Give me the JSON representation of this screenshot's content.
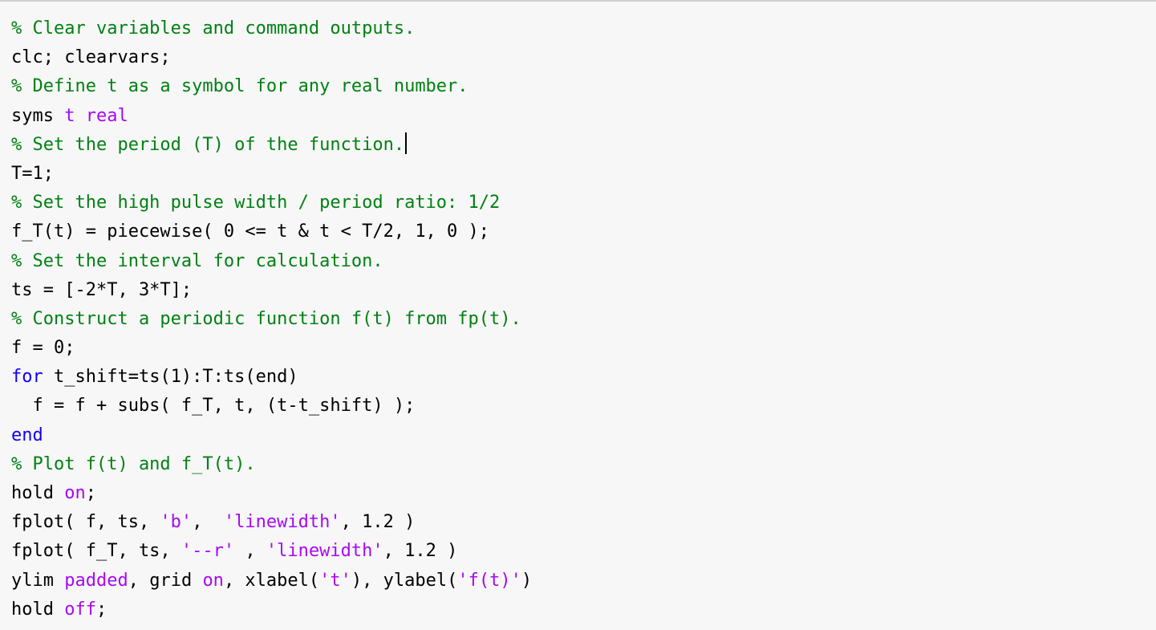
{
  "colors": {
    "background": "#f7f7f7",
    "comment": "#008013",
    "string": "#a709f5",
    "keyword": "#0e00ff",
    "plain": "#000000"
  },
  "editor": {
    "lines": [
      [
        {
          "t": "% Clear variables and command outputs.",
          "k": "comment"
        }
      ],
      [
        {
          "t": "clc; clearvars;",
          "k": "plain"
        }
      ],
      [
        {
          "t": "% Define t as a symbol for any real number.",
          "k": "comment"
        }
      ],
      [
        {
          "t": "syms ",
          "k": "plain"
        },
        {
          "t": "t real",
          "k": "string"
        }
      ],
      [
        {
          "t": "% Set the period (T) of the function.",
          "k": "comment"
        },
        {
          "cursor": true
        }
      ],
      [
        {
          "t": "T=1;",
          "k": "plain"
        }
      ],
      [
        {
          "t": "% Set the high pulse width / period ratio: 1/2",
          "k": "comment"
        }
      ],
      [
        {
          "t": "f_T(t) = piecewise( 0 <= t & t < T/2, 1, 0 );",
          "k": "plain"
        }
      ],
      [
        {
          "t": "% Set the interval for calculation.",
          "k": "comment"
        }
      ],
      [
        {
          "t": "ts = [-2*T, 3*T];",
          "k": "plain"
        }
      ],
      [
        {
          "t": "% Construct a periodic function f(t) from fp(t).",
          "k": "comment"
        }
      ],
      [
        {
          "t": "f = 0;",
          "k": "plain"
        }
      ],
      [
        {
          "t": "for",
          "k": "keyword"
        },
        {
          "t": " t_shift=ts(1):T:ts(end)",
          "k": "plain"
        }
      ],
      [
        {
          "t": "  f = f + subs( f_T, t, (t-t_shift) );",
          "k": "plain"
        }
      ],
      [
        {
          "t": "end",
          "k": "keyword"
        }
      ],
      [
        {
          "t": "% Plot f(t) and f_T(t).",
          "k": "comment"
        }
      ],
      [
        {
          "t": "hold ",
          "k": "plain"
        },
        {
          "t": "on",
          "k": "string"
        },
        {
          "t": ";",
          "k": "plain"
        }
      ],
      [
        {
          "t": "fplot( f, ts, ",
          "k": "plain"
        },
        {
          "t": "'b'",
          "k": "string"
        },
        {
          "t": ",  ",
          "k": "plain"
        },
        {
          "t": "'linewidth'",
          "k": "string"
        },
        {
          "t": ", 1.2 )",
          "k": "plain"
        }
      ],
      [
        {
          "t": "fplot( f_T, ts, ",
          "k": "plain"
        },
        {
          "t": "'--r'",
          "k": "string"
        },
        {
          "t": " , ",
          "k": "plain"
        },
        {
          "t": "'linewidth'",
          "k": "string"
        },
        {
          "t": ", 1.2 )",
          "k": "plain"
        }
      ],
      [
        {
          "t": "ylim ",
          "k": "plain"
        },
        {
          "t": "padded",
          "k": "string"
        },
        {
          "t": ", grid ",
          "k": "plain"
        },
        {
          "t": "on",
          "k": "string"
        },
        {
          "t": ", xlabel(",
          "k": "plain"
        },
        {
          "t": "'t'",
          "k": "string"
        },
        {
          "t": "), ylabel(",
          "k": "plain"
        },
        {
          "t": "'f(t)'",
          "k": "string"
        },
        {
          "t": ")",
          "k": "plain"
        }
      ],
      [
        {
          "t": "hold ",
          "k": "plain"
        },
        {
          "t": "off",
          "k": "string"
        },
        {
          "t": ";",
          "k": "plain"
        }
      ]
    ]
  }
}
